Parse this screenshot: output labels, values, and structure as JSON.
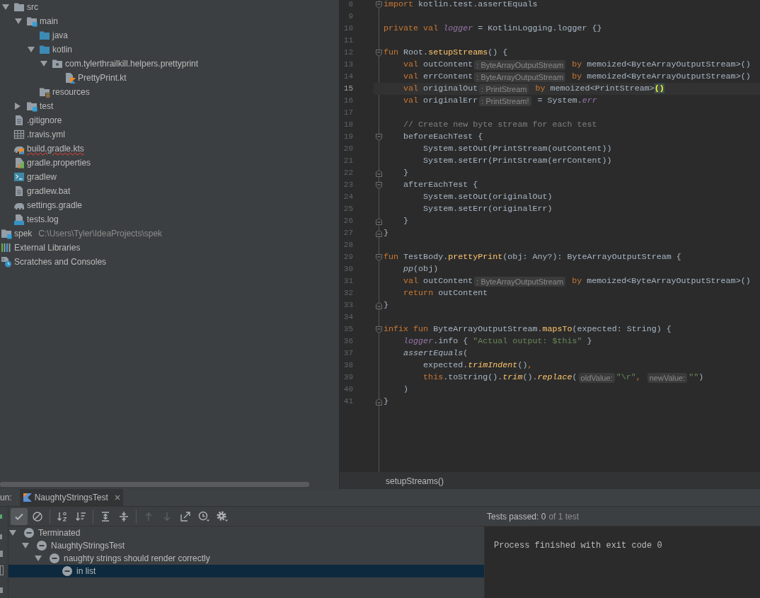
{
  "project_tree": {
    "items": [
      {
        "children": [
          {
            "label": "src",
            "kind": "folder",
            "expanded": true,
            "error": false,
            "children": [
              {
                "label": "main",
                "kind": "module",
                "expanded": true,
                "error": false,
                "children": [
                  {
                    "label": "java",
                    "kind": "source",
                    "error": false
                  },
                  {
                    "label": "kotlin",
                    "kind": "source",
                    "expanded": true,
                    "error": false,
                    "children": [
                      {
                        "label": "com.tylerthrailkill.helpers.prettyprint",
                        "kind": "package",
                        "expanded": true,
                        "error": false,
                        "children": [
                          {
                            "label": "PrettyPrint.kt",
                            "kind": "kotlin",
                            "error": false
                          }
                        ]
                      }
                    ]
                  },
                  {
                    "label": "resources",
                    "kind": "resources",
                    "error": false
                  }
                ]
              },
              {
                "label": "test",
                "kind": "module",
                "expanded": false,
                "error": false
              }
            ]
          },
          {
            "label": ".gitignore",
            "kind": "text",
            "error": false
          },
          {
            "label": ".travis.yml",
            "kind": "table",
            "error": false
          },
          {
            "label": "build.gradle.kts",
            "kind": "gradle_kotlin",
            "error": true
          },
          {
            "label": "gradle.properties",
            "kind": "properties",
            "error": false
          },
          {
            "label": "gradlew",
            "kind": "shell",
            "error": false
          },
          {
            "label": "gradlew.bat",
            "kind": "text",
            "error": false
          },
          {
            "label": "settings.gradle",
            "kind": "gradle",
            "error": false
          },
          {
            "label": "tests.log",
            "kind": "log",
            "error": false
          }
        ]
      },
      {
        "label": "spek",
        "kind": "module",
        "path": "C:\\Users\\Tyler\\IdeaProjects\\spek",
        "error": false
      },
      {
        "label": "External Libraries",
        "kind": "libraries",
        "error": false
      },
      {
        "label": "Scratches and Consoles",
        "kind": "scratches",
        "error": false
      }
    ]
  },
  "editor": {
    "lines": [
      {
        "number": "8",
        "fold": {
          "kind": "start"
        },
        "current": false,
        "tokens": [
          {
            "text": "import",
            "kind": "keyword"
          },
          {
            "text": " kotlin.test.assertEquals",
            "kind": "plain"
          }
        ]
      },
      {
        "number": "9",
        "current": false
      },
      {
        "number": "10",
        "current": false,
        "tokens": [
          {
            "text": "private val ",
            "kind": "keyword"
          },
          {
            "text": "logger",
            "kind": "property"
          },
          {
            "text": " = KotlinLogging.logger {}",
            "kind": "plain"
          }
        ]
      },
      {
        "number": "11",
        "current": false
      },
      {
        "number": "12",
        "fold": {
          "kind": "start"
        },
        "current": false,
        "tokens": [
          {
            "text": "fun",
            "kind": "keyword"
          },
          {
            "text": " Root.",
            "kind": "plain"
          },
          {
            "text": "setupStreams",
            "kind": "function"
          },
          {
            "text": "() {",
            "kind": "plain"
          }
        ]
      },
      {
        "number": "13",
        "current": false,
        "tokens": [
          {
            "text": "    val",
            "kind": "keyword"
          },
          {
            "text": " outContent",
            "kind": "plain"
          },
          {
            "text": ": ByteArrayOutputStream",
            "kind": "hint"
          },
          {
            "text": " by",
            "kind": "keyword"
          },
          {
            "text": " memoized<ByteArrayOutputStream>()",
            "kind": "plain"
          }
        ]
      },
      {
        "number": "14",
        "current": false,
        "tokens": [
          {
            "text": "    val",
            "kind": "keyword"
          },
          {
            "text": " errContent",
            "kind": "plain"
          },
          {
            "text": ": ByteArrayOutputStream",
            "kind": "hint"
          },
          {
            "text": " by",
            "kind": "keyword"
          },
          {
            "text": " memoized<ByteArrayOutputStream>()",
            "kind": "plain"
          }
        ]
      },
      {
        "number": "15",
        "current": true,
        "tokens": [
          {
            "text": "    val",
            "kind": "keyword"
          },
          {
            "text": " originalOut",
            "kind": "plain"
          },
          {
            "text": ": PrintStream",
            "kind": "hint"
          },
          {
            "text": " by",
            "kind": "keyword"
          },
          {
            "text": " memoized<PrintStream>",
            "kind": "plain"
          },
          {
            "text": "()",
            "kind": "match"
          }
        ]
      },
      {
        "number": "16",
        "current": false,
        "tokens": [
          {
            "text": "    val",
            "kind": "keyword"
          },
          {
            "text": " originalErr",
            "kind": "plain"
          },
          {
            "text": ": PrintStream!",
            "kind": "hint"
          },
          {
            "text": " = System.",
            "kind": "plain"
          },
          {
            "text": "err",
            "kind": "static"
          }
        ]
      },
      {
        "number": "17",
        "current": false
      },
      {
        "number": "18",
        "current": false,
        "tokens": [
          {
            "text": "    // Create new byte stream for each test",
            "kind": "comment"
          }
        ]
      },
      {
        "number": "19",
        "fold": {
          "kind": "start"
        },
        "current": false,
        "tokens": [
          {
            "text": "    beforeEachTest {",
            "kind": "plain"
          }
        ]
      },
      {
        "number": "20",
        "current": false,
        "tokens": [
          {
            "text": "        System.setOut(PrintStream(outContent))",
            "kind": "plain"
          }
        ]
      },
      {
        "number": "21",
        "current": false,
        "tokens": [
          {
            "text": "        System.setErr(PrintStream(errContent))",
            "kind": "plain"
          }
        ]
      },
      {
        "number": "22",
        "fold": {
          "kind": "end"
        },
        "current": false,
        "tokens": [
          {
            "text": "    }",
            "kind": "plain"
          }
        ]
      },
      {
        "number": "23",
        "fold": {
          "kind": "start"
        },
        "current": false,
        "tokens": [
          {
            "text": "    afterEachTest {",
            "kind": "plain"
          }
        ]
      },
      {
        "number": "24",
        "current": false,
        "tokens": [
          {
            "text": "        System.setOut(originalOut)",
            "kind": "plain"
          }
        ]
      },
      {
        "number": "25",
        "current": false,
        "tokens": [
          {
            "text": "        System.setErr(originalErr)",
            "kind": "plain"
          }
        ]
      },
      {
        "number": "26",
        "fold": {
          "kind": "end"
        },
        "current": false,
        "tokens": [
          {
            "text": "    }",
            "kind": "plain"
          }
        ]
      },
      {
        "number": "27",
        "fold": {
          "kind": "end"
        },
        "current": false,
        "tokens": [
          {
            "text": "}",
            "kind": "plain"
          }
        ]
      },
      {
        "number": "28",
        "current": false
      },
      {
        "number": "29",
        "fold": {
          "kind": "start"
        },
        "current": false,
        "tokens": [
          {
            "text": "fun",
            "kind": "keyword"
          },
          {
            "text": " TestBody.",
            "kind": "plain"
          },
          {
            "text": "prettyPrint",
            "kind": "function"
          },
          {
            "text": "(obj: Any?): ByteArrayOutputStream {",
            "kind": "plain"
          }
        ]
      },
      {
        "number": "30",
        "current": false,
        "tokens": [
          {
            "text": "    pp",
            "kind": "italic"
          },
          {
            "text": "(obj)",
            "kind": "plain"
          }
        ]
      },
      {
        "number": "31",
        "current": false,
        "tokens": [
          {
            "text": "    val",
            "kind": "keyword"
          },
          {
            "text": " outContent",
            "kind": "plain"
          },
          {
            "text": ": ByteArrayOutputStream",
            "kind": "hint"
          },
          {
            "text": " by",
            "kind": "keyword"
          },
          {
            "text": " memoized<ByteArrayOutputStream>()",
            "kind": "plain"
          }
        ]
      },
      {
        "number": "32",
        "current": false,
        "tokens": [
          {
            "text": "    return",
            "kind": "keyword"
          },
          {
            "text": " outContent",
            "kind": "plain"
          }
        ]
      },
      {
        "number": "33",
        "fold": {
          "kind": "end"
        },
        "current": false,
        "tokens": [
          {
            "text": "}",
            "kind": "plain"
          }
        ]
      },
      {
        "number": "34",
        "current": false
      },
      {
        "number": "35",
        "fold": {
          "kind": "start"
        },
        "current": false,
        "tokens": [
          {
            "text": "infix fun",
            "kind": "keyword"
          },
          {
            "text": " ByteArrayOutputStream.",
            "kind": "plain"
          },
          {
            "text": "mapsTo",
            "kind": "function"
          },
          {
            "text": "(expected: String) {",
            "kind": "plain"
          }
        ]
      },
      {
        "number": "36",
        "current": false,
        "tokens": [
          {
            "text": "    logger",
            "kind": "property"
          },
          {
            "text": ".info { ",
            "kind": "plain"
          },
          {
            "text": "\"Actual output: $this\"",
            "kind": "string"
          },
          {
            "text": " }",
            "kind": "plain"
          }
        ]
      },
      {
        "number": "37",
        "current": false,
        "tokens": [
          {
            "text": "    assertEquals",
            "kind": "italic"
          },
          {
            "text": "(",
            "kind": "plain"
          }
        ]
      },
      {
        "number": "38",
        "current": false,
        "tokens": [
          {
            "text": "        expected.",
            "kind": "plain"
          },
          {
            "text": "trimIndent",
            "kind": "italic_function"
          },
          {
            "text": "()",
            "kind": "plain"
          },
          {
            "text": ",",
            "kind": "keyword"
          }
        ]
      },
      {
        "number": "39",
        "current": false,
        "tokens": [
          {
            "text": "        this",
            "kind": "keyword"
          },
          {
            "text": ".toString().",
            "kind": "plain"
          },
          {
            "text": "trim",
            "kind": "italic_function"
          },
          {
            "text": "().",
            "kind": "plain"
          },
          {
            "text": "replace",
            "kind": "italic_function"
          },
          {
            "text": "(",
            "kind": "plain"
          },
          {
            "text": "oldValue:",
            "kind": "hint"
          },
          {
            "text": "\"\\r\"",
            "kind": "string"
          },
          {
            "text": ", ",
            "kind": "keyword"
          },
          {
            "text": "newValue:",
            "kind": "hint"
          },
          {
            "text": "\"\"",
            "kind": "string"
          },
          {
            "text": ")",
            "kind": "plain"
          }
        ]
      },
      {
        "number": "40",
        "current": false,
        "tokens": [
          {
            "text": "    )",
            "kind": "plain"
          }
        ]
      },
      {
        "number": "41",
        "fold": {
          "kind": "end"
        },
        "current": false,
        "tokens": [
          {
            "text": "}",
            "kind": "plain"
          }
        ]
      }
    ],
    "breadcrumbs": [
      "setupStreams()"
    ]
  },
  "run_panel": {
    "label": "un:",
    "tabs": [
      {
        "label": "NaughtyStringsTest",
        "selected": true
      }
    ],
    "toolbar": {
      "groups": [
        [
          {
            "kind": "check",
            "selected": true,
            "disabled": false
          },
          {
            "kind": "ignore",
            "selected": false,
            "disabled": false
          }
        ],
        [
          {
            "kind": "sort_alpha",
            "selected": false,
            "disabled": false
          },
          {
            "kind": "sort_duration",
            "selected": false,
            "disabled": false
          }
        ],
        [
          {
            "kind": "expand_all",
            "selected": false,
            "disabled": false
          },
          {
            "kind": "collapse_all",
            "selected": false,
            "disabled": false
          }
        ],
        [
          {
            "kind": "up",
            "selected": false,
            "disabled": true
          },
          {
            "kind": "down",
            "selected": false,
            "disabled": true
          },
          {
            "kind": "export",
            "selected": false,
            "disabled": false
          },
          {
            "kind": "history",
            "selected": false,
            "disabled": false
          },
          {
            "kind": "settings",
            "selected": false,
            "disabled": false
          }
        ]
      ]
    },
    "status": {
      "summary": "Tests passed: 0",
      "detail": "of 1 test"
    },
    "test_tree": [
      {
        "label": "Terminated",
        "expanded": true,
        "selected": false,
        "children": [
          {
            "label": "NaughtyStringsTest",
            "expanded": true,
            "selected": false,
            "children": [
              {
                "label": "naughty strings should render correctly",
                "expanded": true,
                "selected": false,
                "children": [
                  {
                    "label": "in list",
                    "selected": true
                  }
                ]
              }
            ]
          }
        ]
      }
    ],
    "console": {
      "lines": [
        "Process finished with exit code 0"
      ]
    }
  }
}
